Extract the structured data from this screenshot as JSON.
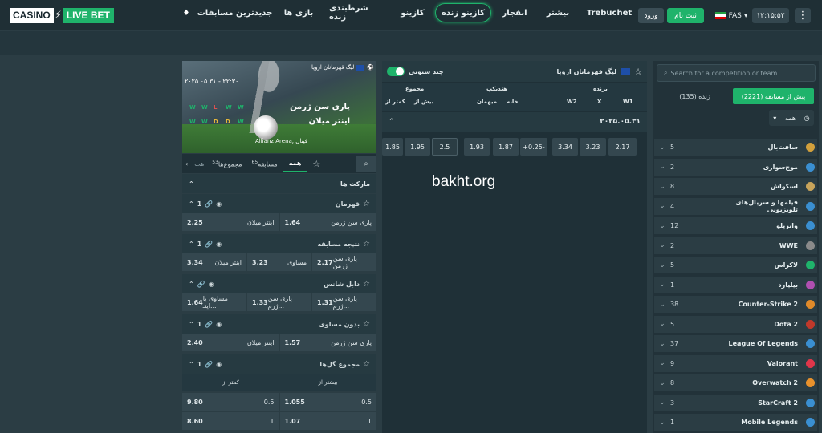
{
  "brand": {
    "casino": "CASINO",
    "live_bet": "LIVE BET"
  },
  "header": {
    "clock": "۱۲:۱۵:۵۲",
    "lang": "FAS",
    "register": "ثبت نام",
    "login": "ورود"
  },
  "nav": [
    "Trebuchet",
    "بیشتر",
    "انفجار",
    "کازینو زنده",
    "کازینو",
    "شرطبندی زنده",
    "بازی ها",
    "جدیدترین مسابقات"
  ],
  "sidebar": {
    "search_placeholder": "Search for a competition or team",
    "tab_pre": "پیش از مسابقه (2221)",
    "tab_live": "زنده (135)",
    "filter": "همه",
    "sports": [
      {
        "name": "سافت‌بال",
        "count": "5",
        "color": "#d2a03c"
      },
      {
        "name": "موج‌سواری",
        "count": "2",
        "color": "#3a8fd1"
      },
      {
        "name": "اسکواش",
        "count": "8",
        "color": "#c7a35a"
      },
      {
        "name": "فیلمها و سریال‌های تلویزیونی",
        "count": "4",
        "color": "#3a8fd1"
      },
      {
        "name": "واترپلو",
        "count": "12",
        "color": "#3a8fd1"
      },
      {
        "name": "WWE",
        "count": "2",
        "color": "#8a8a8a"
      },
      {
        "name": "لاکراس",
        "count": "5",
        "color": "#1fb36b"
      },
      {
        "name": "بیلیارد",
        "count": "1",
        "color": "#b04fb0"
      },
      {
        "name": "Counter-Strike 2",
        "count": "38",
        "color": "#e08a2a"
      },
      {
        "name": "Dota 2",
        "count": "5",
        "color": "#c0392b"
      },
      {
        "name": "League Of Legends",
        "count": "37",
        "color": "#3a8fd1"
      },
      {
        "name": "Valorant",
        "count": "9",
        "color": "#e0364a"
      },
      {
        "name": "Overwatch 2",
        "count": "8",
        "color": "#e8912c"
      },
      {
        "name": "StarCraft 2",
        "count": "3",
        "color": "#3a8fd1"
      },
      {
        "name": "Mobile Legends",
        "count": "1",
        "color": "#3a8fd1"
      }
    ]
  },
  "middle": {
    "league": "لیگ قهرمانان اروپا",
    "multi_col": "چند ستونی",
    "col_winner": "برنده",
    "col_handicap": "هندیکپ",
    "col_total": "مجموع",
    "w1": "W1",
    "x": "X",
    "w2": "W2",
    "home": "خانه",
    "away": "میهمان",
    "over": "بیش از",
    "under": "کمتر از",
    "date": "۲۰۲۵.۰۵.۳۱",
    "odds": [
      "2.17",
      "3.23",
      "3.34",
      "+0.25-",
      "1.87",
      "1.93",
      "2.5",
      "1.95",
      "1.85"
    ],
    "watermark": "bakht.org"
  },
  "banner": {
    "league": "لیگ قهرمانان اروپا",
    "datetime": "۲۰۲۵.۰۵.۳۱ - ۲۲:۳۰",
    "team1": "پاری سن ژرمن",
    "team2": "اینتر میلان",
    "stadium": "Allianz Arena, فینال",
    "form1": [
      "W",
      "W",
      "L",
      "W",
      "W"
    ],
    "form2": [
      "W",
      "W",
      "D",
      "D",
      "W"
    ]
  },
  "left": {
    "tab_all": "همه",
    "tab_match": "مسابقه",
    "tab_match_count": "65",
    "tab_totals": "مجموع‌ها",
    "tab_totals_count": "53",
    "tab_more": "هت",
    "markets_title": "مارکت ها",
    "markets": [
      {
        "name": "قهرمان",
        "count": "1",
        "cells": [
          {
            "l": "پاری سن ژرمن",
            "v": "1.64"
          },
          {
            "l": "اینتر میلان",
            "v": "2.25"
          }
        ]
      },
      {
        "name": "نتیجه مسابقه",
        "count": "1",
        "cells": [
          {
            "l": "پاری سن ژرمن",
            "v": "2.17"
          },
          {
            "l": "مساوی",
            "v": "3.23"
          },
          {
            "l": "اینتر میلان",
            "v": "3.34"
          }
        ]
      },
      {
        "name": "دابل شانس",
        "count": "",
        "cells": [
          {
            "l": "پاری سن ژرم...",
            "v": "1.31"
          },
          {
            "l": "پاری سن ژرم...",
            "v": "1.33"
          },
          {
            "l": "مساوی یا اینـ...",
            "v": "1.64"
          }
        ]
      },
      {
        "name": "بدون مساوی",
        "count": "1",
        "cells": [
          {
            "l": "پاری سن ژرمن",
            "v": "1.57"
          },
          {
            "l": "اینتر میلان",
            "v": "2.40"
          }
        ]
      }
    ],
    "goals": {
      "name": "مجموع گل‌ها",
      "count": "1",
      "over": "بیشتر از",
      "under": "کمتر از",
      "rows": [
        {
          "o_l": "0.5",
          "o_v": "1.055",
          "u_l": "0.5",
          "u_v": "9.80"
        },
        {
          "o_l": "1",
          "o_v": "1.07",
          "u_l": "1",
          "u_v": "8.60"
        }
      ]
    }
  }
}
